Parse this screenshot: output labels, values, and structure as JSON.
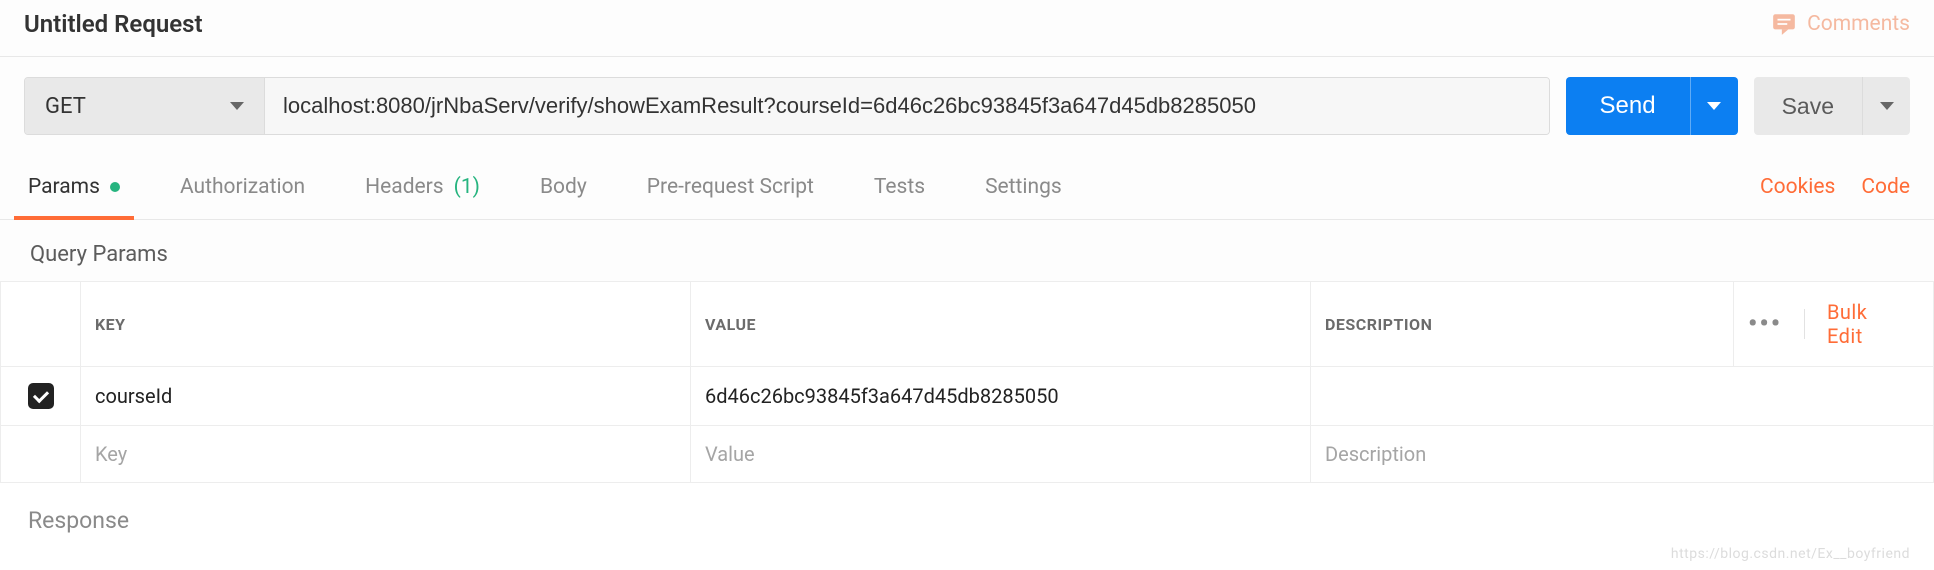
{
  "header": {
    "title": "Untitled Request",
    "comments_label": "Comments"
  },
  "request": {
    "method": "GET",
    "url": "localhost:8080/jrNbaServ/verify/showExamResult?courseId=6d46c26bc93845f3a647d45db8285050",
    "send_label": "Send",
    "save_label": "Save"
  },
  "tabs": {
    "items": [
      {
        "label": "Params",
        "active": true,
        "has_dot": true
      },
      {
        "label": "Authorization"
      },
      {
        "label": "Headers",
        "count": "(1)"
      },
      {
        "label": "Body"
      },
      {
        "label": "Pre-request Script"
      },
      {
        "label": "Tests"
      },
      {
        "label": "Settings"
      }
    ],
    "cookies_label": "Cookies",
    "code_label": "Code"
  },
  "params": {
    "section_title": "Query Params",
    "columns": {
      "key": "KEY",
      "value": "VALUE",
      "description": "DESCRIPTION"
    },
    "bulk_edit_label": "Bulk Edit",
    "rows": [
      {
        "enabled": true,
        "key": "courseId",
        "value": "6d46c26bc93845f3a647d45db8285050",
        "description": ""
      }
    ],
    "placeholders": {
      "key": "Key",
      "value": "Value",
      "description": "Description"
    }
  },
  "response": {
    "title": "Response"
  },
  "watermark": "https://blog.csdn.net/Ex__boyfriend"
}
